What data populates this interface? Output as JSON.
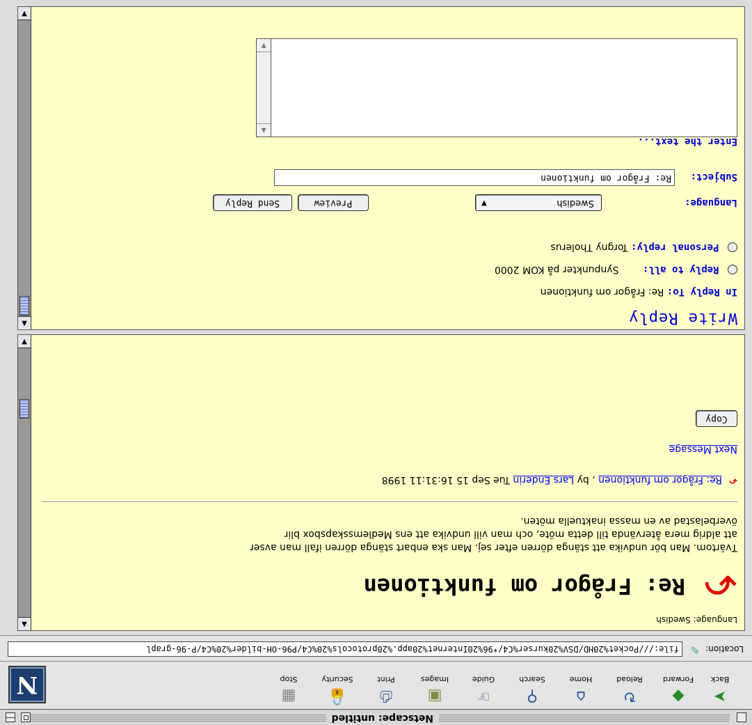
{
  "window": {
    "title": "Netscape: untitled"
  },
  "toolbar": {
    "buttons": [
      {
        "label": "Back",
        "icon": "back-arrow-icon"
      },
      {
        "label": "Forward",
        "icon": "forward-arrow-icon"
      },
      {
        "label": "Reload",
        "icon": "reload-icon"
      },
      {
        "label": "Home",
        "icon": "home-icon"
      },
      {
        "label": "Search",
        "icon": "search-icon"
      },
      {
        "label": "Guide",
        "icon": "guide-icon"
      },
      {
        "label": "Images",
        "icon": "images-icon"
      },
      {
        "label": "Print",
        "icon": "print-icon"
      },
      {
        "label": "Security",
        "icon": "security-icon"
      },
      {
        "label": "Stop",
        "icon": "stop-icon"
      }
    ],
    "logo": "N"
  },
  "location": {
    "label": "Location:",
    "url": "file:///Pocket%20HD/DSV%20kurser%C4/*96%20Internet%20app.%20protocols%20%C4/P96-OH-bilder%20%C4/P-96-grapl"
  },
  "message": {
    "language": "Language: Swedish",
    "title": "Re: Frågor om funktionen",
    "body_lines": [
      "Tvärtom. Man bör undvika att stänga dörren efter sej. Man ska enbart stänga dörren ifall man avser",
      "att aldrig mera återvända till detta möte, och man vill undvika att ens Medlemsskapsbox blir",
      "överbelastad av en massa inaktuella möten."
    ],
    "reply_link": "Re: Frågor om funktionen",
    "reply_by": ", by",
    "reply_author": "Lars Enderin",
    "reply_date": "Tue Sep 15 16:31:11 1998",
    "next_message": "Next Message",
    "copy_label": "Copy"
  },
  "reply": {
    "heading": "Write Reply",
    "in_reply_to_label": "In Reply To:",
    "in_reply_to_value": "Re: Frågor om funktionen",
    "reply_all_label": "Reply to all:",
    "reply_all_value": "Synpunkter på KOM 2000",
    "personal_label": "Personal reply:",
    "personal_value": "Torgny Tholerus",
    "language_label": "Language:",
    "language_value": "Swedish",
    "preview_label": "Preview",
    "send_label": "Send Reply",
    "subject_label": "Subject:",
    "subject_value": "Re: Frågor om funktionen",
    "enter_text_label": "Enter the text..."
  }
}
